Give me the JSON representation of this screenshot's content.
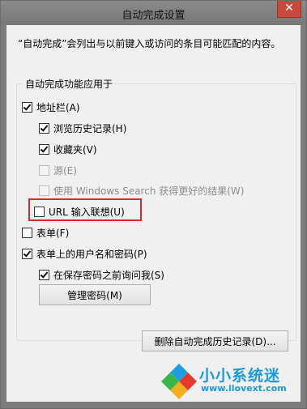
{
  "window": {
    "title": "自动完成设置",
    "close_glyph": "✕"
  },
  "description": "“自动完成”会列出与以前键入或访问的条目可能匹配的内容。",
  "group": {
    "label": "自动完成功能应用于",
    "items": [
      {
        "label": "地址栏(A)",
        "checked": true,
        "enabled": true
      },
      {
        "label": "浏览历史记录(H)",
        "checked": true,
        "enabled": true
      },
      {
        "label": "收藏夹(V)",
        "checked": true,
        "enabled": true
      },
      {
        "label": "源(E)",
        "checked": false,
        "enabled": false
      },
      {
        "label": "使用 Windows Search 获得更好的结果(W)",
        "checked": false,
        "enabled": false
      },
      {
        "label": "URL 输入联想(U)",
        "checked": false,
        "enabled": true
      },
      {
        "label": "表单(F)",
        "checked": false,
        "enabled": true
      },
      {
        "label": "表单上的用户名和密码(P)",
        "checked": true,
        "enabled": true
      },
      {
        "label": "在保存密码之前询问我(S)",
        "checked": true,
        "enabled": true
      }
    ],
    "manage_passwords_button": "管理密码(M)"
  },
  "delete_history_button": "删除自动完成历史记录(D)...",
  "watermark": {
    "brand": "小小系统迷",
    "url": "www.ilovext.com"
  },
  "colors": {
    "highlight": "#d52b2b",
    "watermark": "#1a9ad6"
  }
}
